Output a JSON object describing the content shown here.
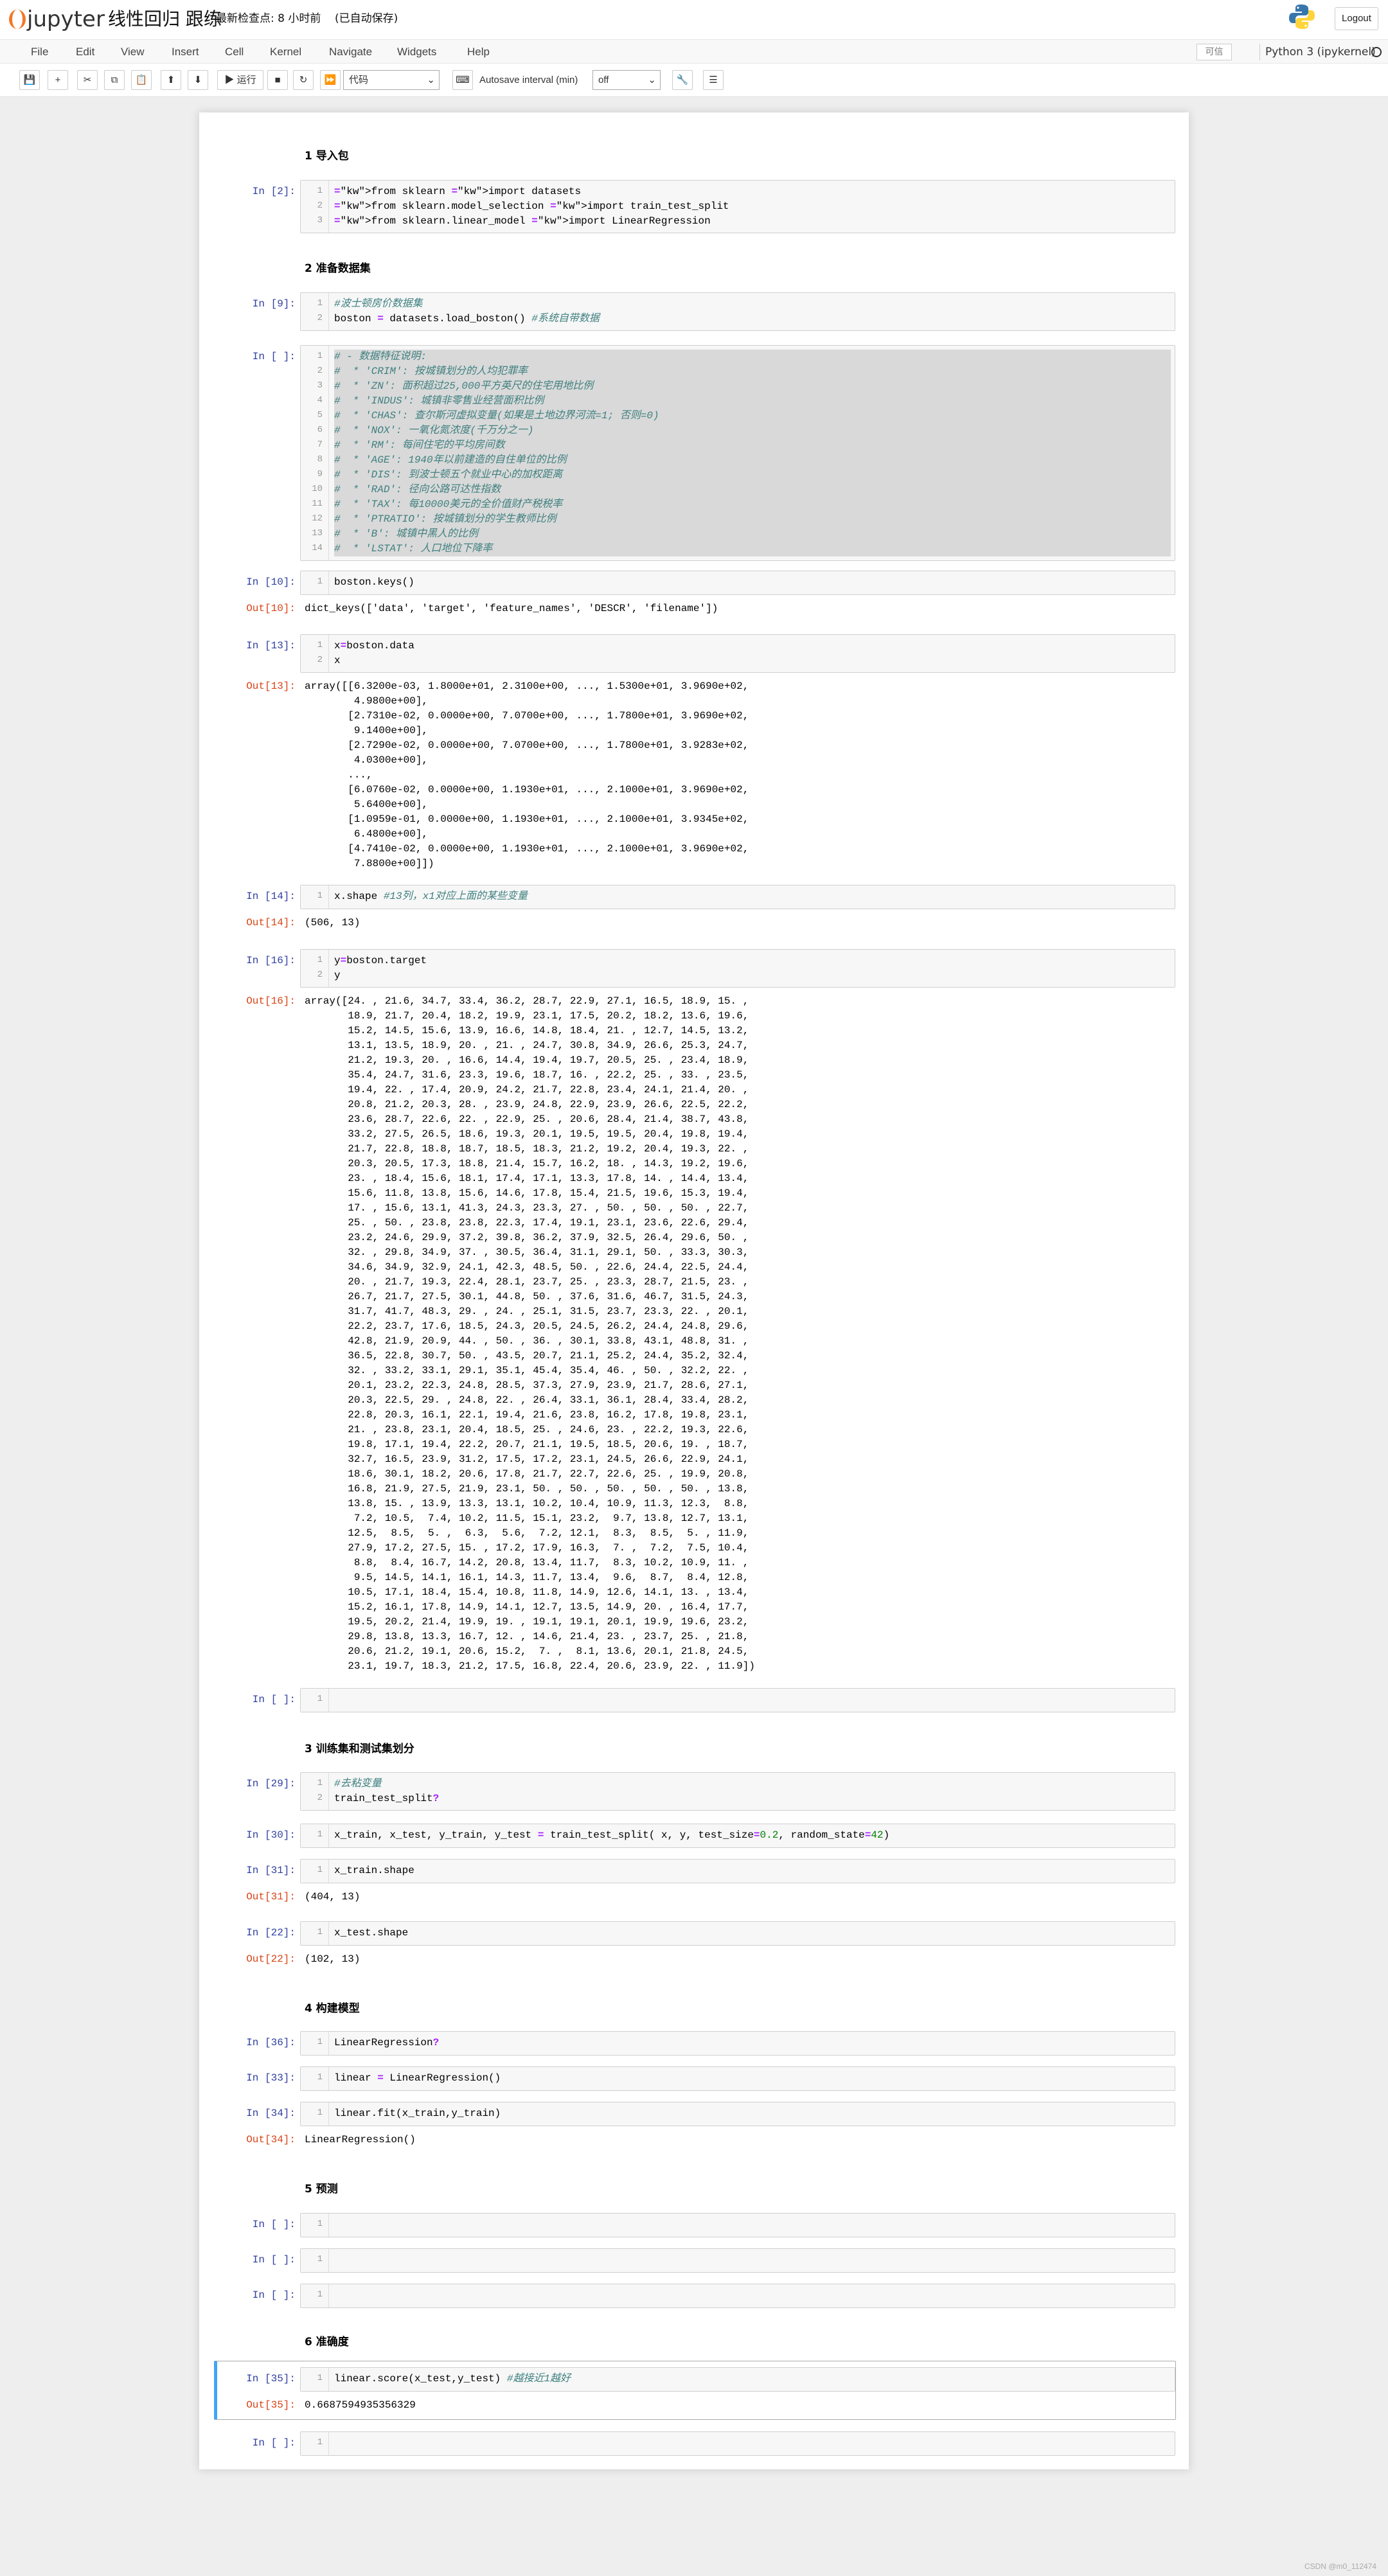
{
  "app": {
    "name": "jupyter",
    "notebook_title": "线性回归 跟练",
    "checkpoint": "最新检查点: 8 小时前",
    "autosave": "(已自动保存)",
    "logout": "Logout",
    "trusted": "可信",
    "kernel": "Python 3 (ipykernel)"
  },
  "menu": [
    "File",
    "Edit",
    "View",
    "Insert",
    "Cell",
    "Kernel",
    "Navigate",
    "Widgets",
    "Help"
  ],
  "toolbar": {
    "run": "▶ 运行",
    "cell_type": "代码",
    "autosave_label": "Autosave interval (min)",
    "autosave_value": "off"
  },
  "headings": {
    "h1": "1 导入包",
    "h2": "2 准备数据集",
    "h3": "3 训练集和测试集划分",
    "h4": "4 构建模型",
    "h5": "5 预测",
    "h6": "6 准确度"
  },
  "cells": {
    "c1": {
      "prompt": "In  [2]:",
      "lines": [
        "from sklearn import datasets",
        "from sklearn.model_selection import train_test_split",
        "from sklearn.linear_model import LinearRegression"
      ]
    },
    "c2": {
      "prompt": "In  [9]:",
      "lines": [
        "#波士顿房价数据集",
        "boston = datasets.load_boston() #系统自带数据"
      ]
    },
    "c3": {
      "prompt": "In  [ ]:",
      "lines": [
        "# - 数据特征说明:",
        "#  * 'CRIM': 按城镇划分的人均犯罪率",
        "#  * 'ZN': 面积超过25,000平方英尺的住宅用地比例",
        "#  * 'INDUS': 城镇非零售业经营面积比例",
        "#  * 'CHAS': 查尔斯河虚拟变量(如果是土地边界河流=1; 否则=0)",
        "#  * 'NOX': 一氧化氮浓度(千万分之一)",
        "#  * 'RM': 每间住宅的平均房间数",
        "#  * 'AGE': 1940年以前建造的自住单位的比例",
        "#  * 'DIS': 到波士顿五个就业中心的加权距离",
        "#  * 'RAD': 径向公路可达性指数",
        "#  * 'TAX': 每10000美元的全价值财产税税率",
        "#  * 'PTRATIO': 按城镇划分的学生教师比例",
        "#  * 'B': 城镇中黑人的比例",
        "#  * 'LSTAT': 人口地位下降率"
      ]
    },
    "c4": {
      "prompt": "In  [10]:",
      "lines": [
        "boston.keys()"
      ],
      "out_prompt": "Out[10]:",
      "output": "dict_keys(['data', 'target', 'feature_names', 'DESCR', 'filename'])"
    },
    "c5": {
      "prompt": "In  [13]:",
      "lines": [
        "x=boston.data",
        "x"
      ],
      "out_prompt": "Out[13]:",
      "output": "array([[6.3200e-03, 1.8000e+01, 2.3100e+00, ..., 1.5300e+01, 3.9690e+02,\n        4.9800e+00],\n       [2.7310e-02, 0.0000e+00, 7.0700e+00, ..., 1.7800e+01, 3.9690e+02,\n        9.1400e+00],\n       [2.7290e-02, 0.0000e+00, 7.0700e+00, ..., 1.7800e+01, 3.9283e+02,\n        4.0300e+00],\n       ...,\n       [6.0760e-02, 0.0000e+00, 1.1930e+01, ..., 2.1000e+01, 3.9690e+02,\n        5.6400e+00],\n       [1.0959e-01, 0.0000e+00, 1.1930e+01, ..., 2.1000e+01, 3.9345e+02,\n        6.4800e+00],\n       [4.7410e-02, 0.0000e+00, 1.1930e+01, ..., 2.1000e+01, 3.9690e+02,\n        7.8800e+00]])"
    },
    "c6": {
      "prompt": "In  [14]:",
      "lines": [
        "x.shape #13列，x1对应上面的某些变量"
      ],
      "out_prompt": "Out[14]:",
      "output": "(506, 13)"
    },
    "c7": {
      "prompt": "In  [16]:",
      "lines": [
        "y=boston.target",
        "y"
      ],
      "out_prompt": "Out[16]:",
      "output": "array([24. , 21.6, 34.7, 33.4, 36.2, 28.7, 22.9, 27.1, 16.5, 18.9, 15. ,\n       18.9, 21.7, 20.4, 18.2, 19.9, 23.1, 17.5, 20.2, 18.2, 13.6, 19.6,\n       15.2, 14.5, 15.6, 13.9, 16.6, 14.8, 18.4, 21. , 12.7, 14.5, 13.2,\n       13.1, 13.5, 18.9, 20. , 21. , 24.7, 30.8, 34.9, 26.6, 25.3, 24.7,\n       21.2, 19.3, 20. , 16.6, 14.4, 19.4, 19.7, 20.5, 25. , 23.4, 18.9,\n       35.4, 24.7, 31.6, 23.3, 19.6, 18.7, 16. , 22.2, 25. , 33. , 23.5,\n       19.4, 22. , 17.4, 20.9, 24.2, 21.7, 22.8, 23.4, 24.1, 21.4, 20. ,\n       20.8, 21.2, 20.3, 28. , 23.9, 24.8, 22.9, 23.9, 26.6, 22.5, 22.2,\n       23.6, 28.7, 22.6, 22. , 22.9, 25. , 20.6, 28.4, 21.4, 38.7, 43.8,\n       33.2, 27.5, 26.5, 18.6, 19.3, 20.1, 19.5, 19.5, 20.4, 19.8, 19.4,\n       21.7, 22.8, 18.8, 18.7, 18.5, 18.3, 21.2, 19.2, 20.4, 19.3, 22. ,\n       20.3, 20.5, 17.3, 18.8, 21.4, 15.7, 16.2, 18. , 14.3, 19.2, 19.6,\n       23. , 18.4, 15.6, 18.1, 17.4, 17.1, 13.3, 17.8, 14. , 14.4, 13.4,\n       15.6, 11.8, 13.8, 15.6, 14.6, 17.8, 15.4, 21.5, 19.6, 15.3, 19.4,\n       17. , 15.6, 13.1, 41.3, 24.3, 23.3, 27. , 50. , 50. , 50. , 22.7,\n       25. , 50. , 23.8, 23.8, 22.3, 17.4, 19.1, 23.1, 23.6, 22.6, 29.4,\n       23.2, 24.6, 29.9, 37.2, 39.8, 36.2, 37.9, 32.5, 26.4, 29.6, 50. ,\n       32. , 29.8, 34.9, 37. , 30.5, 36.4, 31.1, 29.1, 50. , 33.3, 30.3,\n       34.6, 34.9, 32.9, 24.1, 42.3, 48.5, 50. , 22.6, 24.4, 22.5, 24.4,\n       20. , 21.7, 19.3, 22.4, 28.1, 23.7, 25. , 23.3, 28.7, 21.5, 23. ,\n       26.7, 21.7, 27.5, 30.1, 44.8, 50. , 37.6, 31.6, 46.7, 31.5, 24.3,\n       31.7, 41.7, 48.3, 29. , 24. , 25.1, 31.5, 23.7, 23.3, 22. , 20.1,\n       22.2, 23.7, 17.6, 18.5, 24.3, 20.5, 24.5, 26.2, 24.4, 24.8, 29.6,\n       42.8, 21.9, 20.9, 44. , 50. , 36. , 30.1, 33.8, 43.1, 48.8, 31. ,\n       36.5, 22.8, 30.7, 50. , 43.5, 20.7, 21.1, 25.2, 24.4, 35.2, 32.4,\n       32. , 33.2, 33.1, 29.1, 35.1, 45.4, 35.4, 46. , 50. , 32.2, 22. ,\n       20.1, 23.2, 22.3, 24.8, 28.5, 37.3, 27.9, 23.9, 21.7, 28.6, 27.1,\n       20.3, 22.5, 29. , 24.8, 22. , 26.4, 33.1, 36.1, 28.4, 33.4, 28.2,\n       22.8, 20.3, 16.1, 22.1, 19.4, 21.6, 23.8, 16.2, 17.8, 19.8, 23.1,\n       21. , 23.8, 23.1, 20.4, 18.5, 25. , 24.6, 23. , 22.2, 19.3, 22.6,\n       19.8, 17.1, 19.4, 22.2, 20.7, 21.1, 19.5, 18.5, 20.6, 19. , 18.7,\n       32.7, 16.5, 23.9, 31.2, 17.5, 17.2, 23.1, 24.5, 26.6, 22.9, 24.1,\n       18.6, 30.1, 18.2, 20.6, 17.8, 21.7, 22.7, 22.6, 25. , 19.9, 20.8,\n       16.8, 21.9, 27.5, 21.9, 23.1, 50. , 50. , 50. , 50. , 50. , 13.8,\n       13.8, 15. , 13.9, 13.3, 13.1, 10.2, 10.4, 10.9, 11.3, 12.3,  8.8,\n        7.2, 10.5,  7.4, 10.2, 11.5, 15.1, 23.2,  9.7, 13.8, 12.7, 13.1,\n       12.5,  8.5,  5. ,  6.3,  5.6,  7.2, 12.1,  8.3,  8.5,  5. , 11.9,\n       27.9, 17.2, 27.5, 15. , 17.2, 17.9, 16.3,  7. ,  7.2,  7.5, 10.4,\n        8.8,  8.4, 16.7, 14.2, 20.8, 13.4, 11.7,  8.3, 10.2, 10.9, 11. ,\n        9.5, 14.5, 14.1, 16.1, 14.3, 11.7, 13.4,  9.6,  8.7,  8.4, 12.8,\n       10.5, 17.1, 18.4, 15.4, 10.8, 11.8, 14.9, 12.6, 14.1, 13. , 13.4,\n       15.2, 16.1, 17.8, 14.9, 14.1, 12.7, 13.5, 14.9, 20. , 16.4, 17.7,\n       19.5, 20.2, 21.4, 19.9, 19. , 19.1, 19.1, 20.1, 19.9, 19.6, 23.2,\n       29.8, 13.8, 13.3, 16.7, 12. , 14.6, 21.4, 23. , 23.7, 25. , 21.8,\n       20.6, 21.2, 19.1, 20.6, 15.2,  7. ,  8.1, 13.6, 20.1, 21.8, 24.5,\n       23.1, 19.7, 18.3, 21.2, 17.5, 16.8, 22.4, 20.6, 23.9, 22. , 11.9])"
    },
    "c8": {
      "prompt": "In  [ ]:"
    },
    "c9": {
      "prompt": "In  [29]:",
      "lines": [
        "#去粘变量",
        "train_test_split?"
      ]
    },
    "c10": {
      "prompt": "In  [30]:",
      "lines": [
        "x_train, x_test, y_train, y_test = train_test_split( x, y, test_size=0.2, random_state=42)"
      ]
    },
    "c11": {
      "prompt": "In  [31]:",
      "lines": [
        "x_train.shape"
      ],
      "out_prompt": "Out[31]:",
      "output": "(404, 13)"
    },
    "c12": {
      "prompt": "In  [22]:",
      "lines": [
        "x_test.shape"
      ],
      "out_prompt": "Out[22]:",
      "output": "(102, 13)"
    },
    "c13": {
      "prompt": "In  [36]:",
      "lines": [
        "LinearRegression?"
      ]
    },
    "c14": {
      "prompt": "In  [33]:",
      "lines": [
        "linear = LinearRegression()"
      ]
    },
    "c15": {
      "prompt": "In  [34]:",
      "lines": [
        "linear.fit(x_train,y_train)"
      ],
      "out_prompt": "Out[34]:",
      "output": "LinearRegression()"
    },
    "c16": {
      "prompt": "In  [ ]:"
    },
    "c17": {
      "prompt": "In  [ ]:"
    },
    "c18": {
      "prompt": "In  [ ]:"
    },
    "c19": {
      "prompt": "In  [35]:",
      "lines": [
        "linear.score(x_test,y_test) #越接近1越好"
      ],
      "out_prompt": "Out[35]:",
      "output": "0.6687594935356329"
    },
    "c20": {
      "prompt": "In  [ ]:"
    }
  },
  "watermark": "CSDN @m0_112474"
}
